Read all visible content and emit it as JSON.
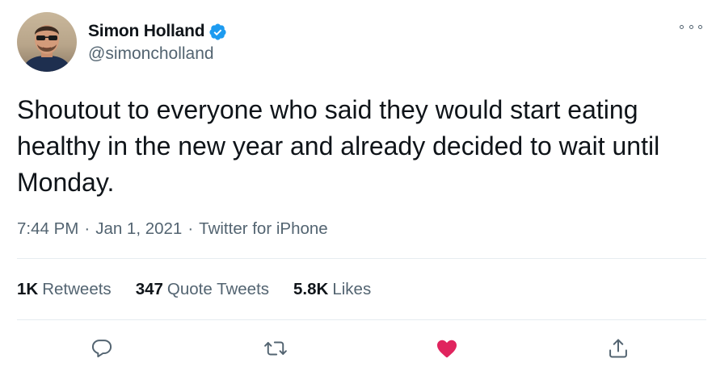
{
  "author": {
    "display_name": "Simon Holland",
    "handle": "@simoncholland",
    "verified": true
  },
  "tweet": {
    "text": "Shoutout to everyone who said they would start eating healthy in the new year and already decided to wait until Monday.",
    "time": "7:44 PM",
    "separator": "·",
    "date": "Jan 1, 2021",
    "source": "Twitter for iPhone"
  },
  "stats": {
    "retweets_count": "1K",
    "retweets_label": "Retweets",
    "quotes_count": "347",
    "quotes_label": "Quote Tweets",
    "likes_count": "5.8K",
    "likes_label": "Likes"
  },
  "icons": {
    "verified": "verified-badge-icon",
    "more": "more-options-icon",
    "reply": "reply-icon",
    "retweet": "retweet-icon",
    "like": "heart-icon",
    "share": "share-icon"
  },
  "colors": {
    "verified_blue": "#1d9bf0",
    "like_active": "#e0245e",
    "muted_text": "#536471",
    "primary_text": "#0f1419"
  },
  "state": {
    "liked": true
  }
}
